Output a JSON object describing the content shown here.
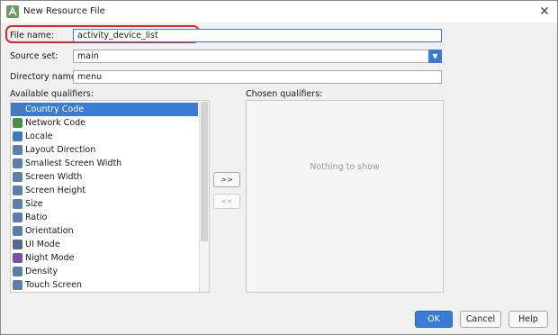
{
  "window": {
    "title": "New Resource File",
    "close_glyph": "✕",
    "app_icon": "android-studio-icon"
  },
  "form": {
    "file_name_label": "File name:",
    "file_name_value": "activity_device_list",
    "source_set_label": "Source set:",
    "source_set_value": "main",
    "directory_name_label": "Directory name:",
    "directory_name_value": "menu"
  },
  "qualifiers": {
    "available_label": "Available qualifiers:",
    "chosen_label": "Chosen qualifiers:",
    "empty_text": "Nothing to show",
    "selected_index": 0,
    "items": [
      "Country Code",
      "Network Code",
      "Locale",
      "Layout Direction",
      "Smallest Screen Width",
      "Screen Width",
      "Screen Height",
      "Size",
      "Ratio",
      "Orientation",
      "UI Mode",
      "Night Mode",
      "Density",
      "Touch Screen"
    ],
    "add_label": ">>",
    "remove_label": "<<"
  },
  "buttons": {
    "ok": "OK",
    "cancel": "Cancel",
    "help": "Help"
  },
  "colors": {
    "accent": "#3a7bd5",
    "highlight_outline": "#d72b2b"
  }
}
